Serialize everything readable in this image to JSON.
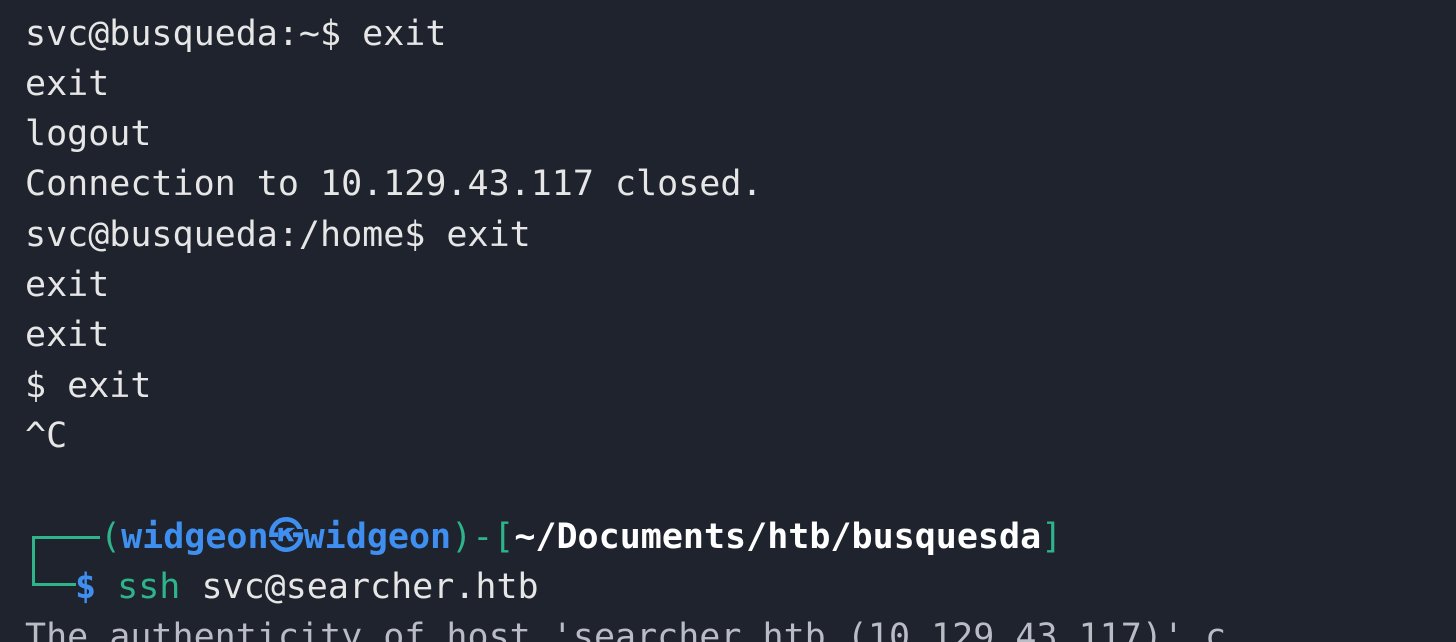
{
  "terminal": {
    "colors": {
      "background": "#1f232d",
      "text": "#e6e6e6",
      "prompt_frame": "#2eb38a",
      "user_host": "#3f8ff0",
      "path": "#ffffff"
    },
    "lines": [
      "svc@busqueda:~$ exit",
      "exit",
      "logout",
      "Connection to 10.129.43.117 closed.",
      "svc@busqueda:/home$ exit",
      "exit",
      "exit",
      "$ exit",
      "^C"
    ],
    "prompt": {
      "open_paren": "(",
      "user": "widgeon",
      "at_symbol": "㉿",
      "host": "widgeon",
      "close_paren": ")-[",
      "path": "~/Documents/htb/busquesda",
      "close_bracket": "]",
      "dollar": "$",
      "command": "ssh",
      "args": " svc@searcher.htb"
    },
    "partial_line": "The authenticity of host 'searcher.htb (10.129.43.117)' c"
  }
}
